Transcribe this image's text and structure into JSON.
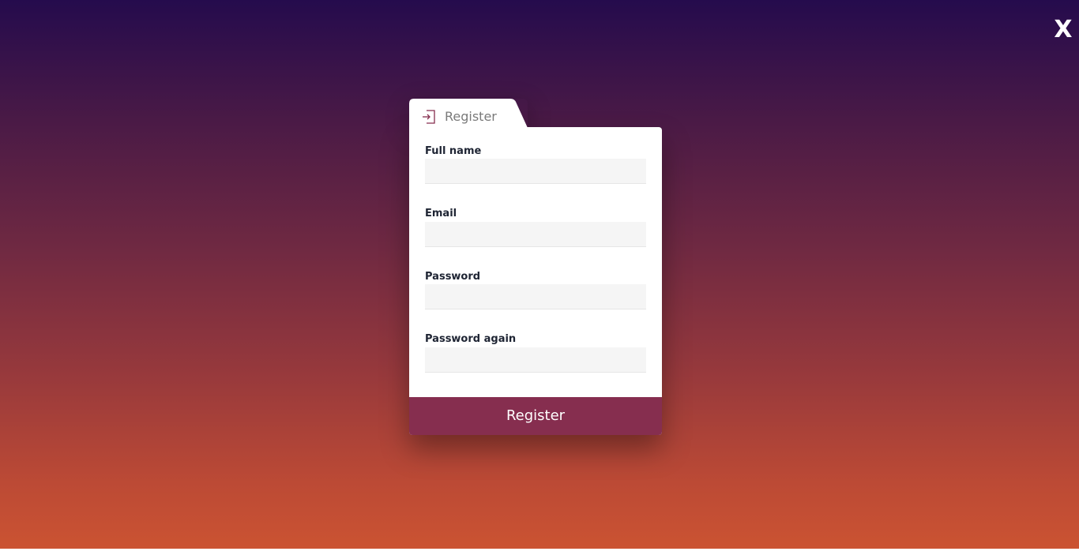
{
  "close": {
    "label": "X"
  },
  "tab": {
    "label": "Register",
    "icon": "sign-in-icon",
    "accent": "#862e4f"
  },
  "form": {
    "fields": [
      {
        "label": "Full name",
        "value": "",
        "placeholder": ""
      },
      {
        "label": "Email",
        "value": "",
        "placeholder": ""
      },
      {
        "label": "Password",
        "value": "",
        "placeholder": ""
      },
      {
        "label": "Password again",
        "value": "",
        "placeholder": ""
      }
    ],
    "submit_label": "Register"
  },
  "colors": {
    "gradient_top": "#250b4d",
    "gradient_bottom": "#cb5332",
    "button": "#862e4f",
    "input_bg": "#f5f5f5"
  }
}
